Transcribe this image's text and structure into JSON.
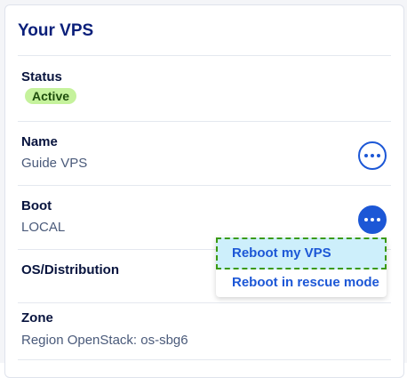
{
  "card": {
    "title": "Your VPS"
  },
  "rows": {
    "status": {
      "label": "Status",
      "badge": "Active"
    },
    "name": {
      "label": "Name",
      "value": "Guide VPS"
    },
    "boot": {
      "label": "Boot",
      "value": "LOCAL"
    },
    "os": {
      "label": "OS/Distribution"
    },
    "zone": {
      "label": "Zone",
      "value": "Region OpenStack: os-sbg6"
    }
  },
  "menu": {
    "items": [
      {
        "label": "Reboot my VPS"
      },
      {
        "label": "Reboot in rescue mode"
      }
    ]
  },
  "colors": {
    "accent": "#1c57d6",
    "badge_bg": "#c5f29c",
    "hover_bg": "#cdeffb"
  }
}
